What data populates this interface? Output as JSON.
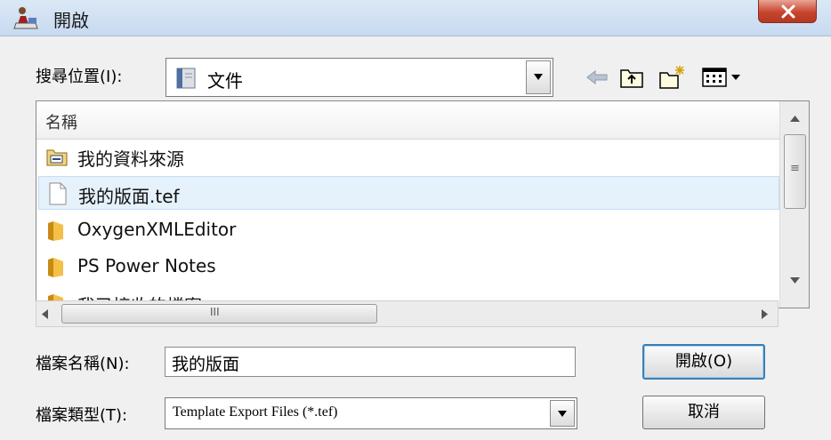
{
  "window": {
    "title": "開啟",
    "icon": "app-icon",
    "close_icon": "close-icon"
  },
  "look_in": {
    "label": "搜尋位置(I):",
    "value": "文件",
    "folder_icon": "documents-folder-icon"
  },
  "toolbar": {
    "back_icon": "back-arrow-icon",
    "up_icon": "up-folder-icon",
    "new_folder_icon": "new-folder-icon",
    "view_icon": "view-menu-icon"
  },
  "file_list": {
    "column_header": "名稱",
    "items": [
      {
        "label": "我的資料來源",
        "icon": "data-source-folder-icon",
        "selected": false
      },
      {
        "label": "我的版面.tef",
        "icon": "file-icon",
        "selected": true
      },
      {
        "label": "OxygenXMLEditor",
        "icon": "folder-icon",
        "selected": false
      },
      {
        "label": "PS Power Notes",
        "icon": "folder-icon",
        "selected": false
      },
      {
        "label": "我已接收的檔案",
        "icon": "folder-icon",
        "selected": false
      }
    ]
  },
  "file_name": {
    "label": "檔案名稱(N):",
    "value": "我的版面"
  },
  "file_type": {
    "label": "檔案類型(T):",
    "value": "Template Export Files (*.tef)"
  },
  "buttons": {
    "open": "開啟(O)",
    "cancel": "取消"
  },
  "scrollbar": {
    "grip": "≡",
    "h_thumb_label": "III"
  }
}
